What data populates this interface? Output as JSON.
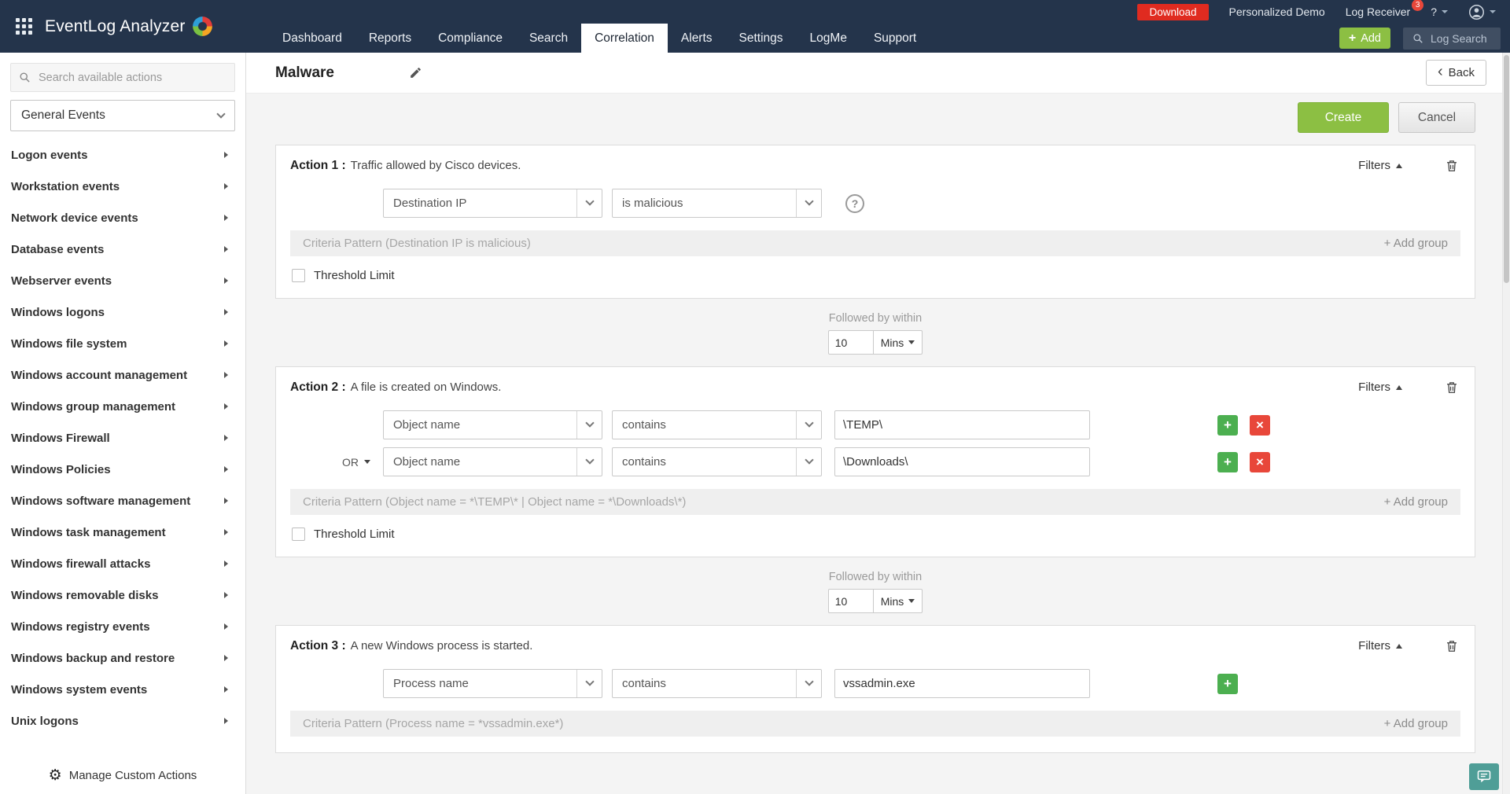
{
  "colors": {
    "topbar_bg": "#24344b",
    "accent_green": "#8cbf43",
    "download_red": "#e02b20",
    "row_add_green": "#4caf50",
    "row_remove_red": "#e8473a",
    "fab_teal": "#4f9e97"
  },
  "topbar": {
    "brand": "EventLog Analyzer",
    "nav": [
      "Dashboard",
      "Reports",
      "Compliance",
      "Search",
      "Correlation",
      "Alerts",
      "Settings",
      "LogMe",
      "Support"
    ],
    "active_tab": "Correlation",
    "download_label": "Download",
    "personalized_demo_label": "Personalized Demo",
    "log_receiver_label": "Log Receiver",
    "notification_count": "3",
    "help_label": "?",
    "add_plus": "+",
    "add_label": "Add",
    "log_search_label": "Log Search"
  },
  "sidebar": {
    "search_placeholder": "Search available actions",
    "category": "General Events",
    "items": [
      "Logon events",
      "Workstation events",
      "Network device events",
      "Database events",
      "Webserver events",
      "Windows logons",
      "Windows file system",
      "Windows account management",
      "Windows group management",
      "Windows Firewall",
      "Windows Policies",
      "Windows software management",
      "Windows task management",
      "Windows firewall attacks",
      "Windows removable disks",
      "Windows registry events",
      "Windows backup and restore",
      "Windows system events",
      "Unix logons"
    ],
    "footer_label": "Manage Custom Actions"
  },
  "main": {
    "title": "Malware",
    "back_label": "Back",
    "create_label": "Create",
    "cancel_label": "Cancel"
  },
  "followed_by": [
    {
      "label": "Followed by within",
      "value": "10",
      "unit": "Mins"
    },
    {
      "label": "Followed by within",
      "value": "10",
      "unit": "Mins"
    }
  ],
  "actions": [
    {
      "title": "Action 1 :",
      "description": "Traffic allowed by Cisco devices.",
      "filters": "Filters",
      "rows": [
        {
          "field": "Destination IP",
          "operator": "is malicious"
        }
      ],
      "criteria": "Criteria Pattern (Destination IP is malicious)",
      "add_group": "+ Add group",
      "threshold": "Threshold Limit"
    },
    {
      "title": "Action 2 :",
      "description": "A file is created on Windows.",
      "filters": "Filters",
      "rows": [
        {
          "field": "Object name",
          "operator": "contains",
          "value": "\\TEMP\\"
        },
        {
          "join": "OR",
          "field": "Object name",
          "operator": "contains",
          "value": "\\Downloads\\"
        }
      ],
      "criteria": "Criteria Pattern (Object name = *\\TEMP\\* | Object name = *\\Downloads\\*)",
      "add_group": "+ Add group",
      "threshold": "Threshold Limit"
    },
    {
      "title": "Action 3 :",
      "description": "A new Windows process is started.",
      "filters": "Filters",
      "rows": [
        {
          "field": "Process name",
          "operator": "contains",
          "value": "vssadmin.exe"
        }
      ],
      "criteria": "Criteria Pattern (Process name = *vssadmin.exe*)",
      "add_group": "+ Add group"
    }
  ]
}
